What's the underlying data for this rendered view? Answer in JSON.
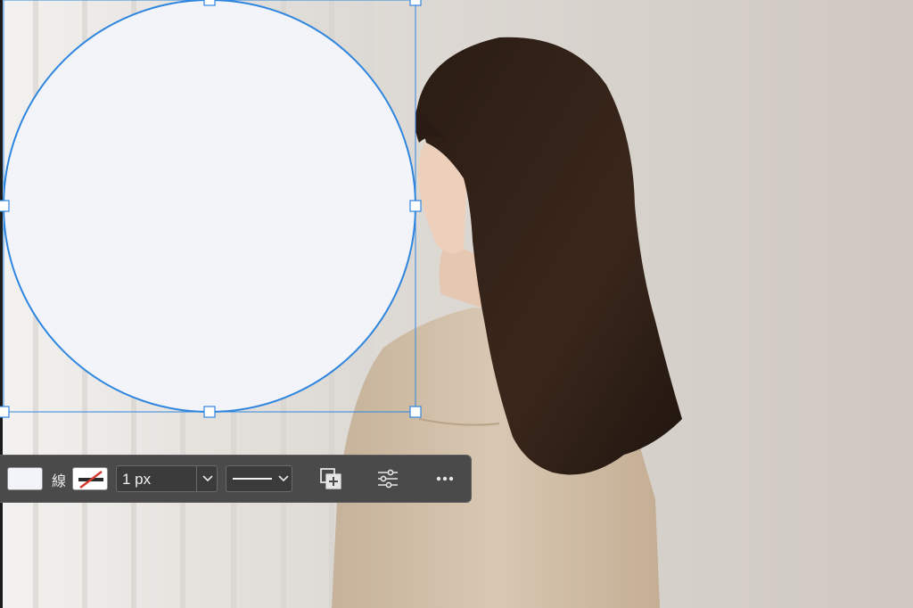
{
  "toolbar": {
    "fill_color": "#f2f4f9",
    "stroke_label": "線",
    "stroke_color": "none",
    "stroke_width": {
      "value": "1 px"
    },
    "stroke_style": "solid-line",
    "icons": {
      "stroke_swatch": "no-stroke-icon",
      "width_dropdown": "chevron-down-icon",
      "style_dropdown": "chevron-down-icon",
      "combine": "add-shape-icon",
      "adjust": "sliders-icon",
      "more": "more-icon"
    }
  },
  "selection": {
    "shape": "ellipse",
    "fill": "#f2f4f9",
    "stroke": "#2f86df"
  },
  "colors": {
    "toolbar_bg": "#4a4a4a",
    "selection_accent": "#2f86df"
  }
}
